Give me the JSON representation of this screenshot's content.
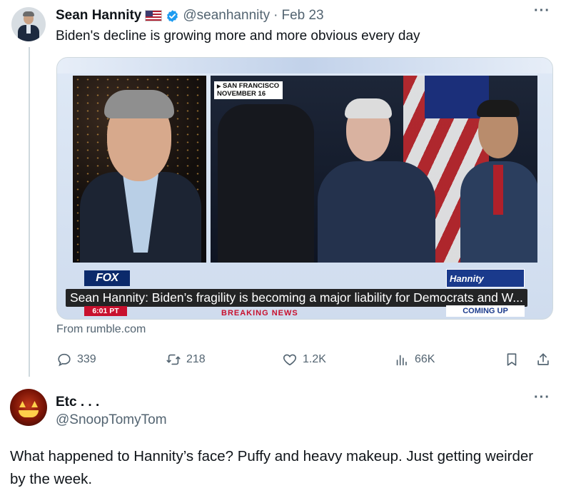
{
  "tweet": {
    "name": "Sean Hannity",
    "flag": "🇺🇸",
    "handle": "@seanhannity",
    "separator": "·",
    "date": "Feb 23",
    "more": "···",
    "text": "Biden's decline is growing more and more obvious every day",
    "media": {
      "location_line1": "SAN FRANCISCO",
      "location_line2": "NOVEMBER 16",
      "network": "FOX",
      "show_logo": "Hannity",
      "caption": "Sean Hannity: Biden’s fragility is becoming a major liability for Democrats and W...",
      "time": "6:01 PT",
      "breaking": "BREAKING NEWS",
      "coming_up": "COMING UP"
    },
    "source": "From rumble.com",
    "actions": {
      "replies": "339",
      "reposts": "218",
      "likes": "1.2K",
      "views": "66K"
    }
  },
  "reply": {
    "name": "Etc . . .",
    "handle": "@SnoopTomyTom",
    "more": "···",
    "text": "What happened to Hannity’s face?  Puffy and heavy makeup.  Just getting weirder by the week."
  },
  "colors": {
    "text": "#0f1419",
    "muted": "#536471",
    "verified": "#1d9bf0",
    "fox_red": "#c8102e"
  }
}
